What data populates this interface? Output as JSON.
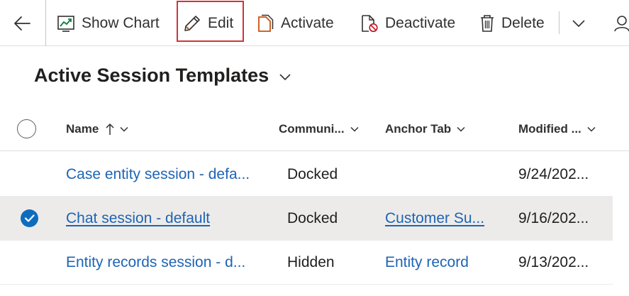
{
  "toolbar": {
    "show_chart": "Show Chart",
    "edit": "Edit",
    "activate": "Activate",
    "deactivate": "Deactivate",
    "delete": "Delete"
  },
  "view": {
    "title": "Active Session Templates"
  },
  "grid": {
    "columns": [
      "Name",
      "Communi...",
      "Anchor Tab",
      "Modified ..."
    ],
    "rows": [
      {
        "name": "Case entity session - defa...",
        "communication": "Docked",
        "anchor_tab": "",
        "modified": "9/24/202...",
        "selected": false
      },
      {
        "name": "Chat session - default",
        "communication": "Docked",
        "anchor_tab": "Customer Su...",
        "modified": "9/16/202...",
        "selected": true
      },
      {
        "name": "Entity records session - d...",
        "communication": "Hidden",
        "anchor_tab": "Entity record",
        "modified": "9/13/202...",
        "selected": false
      }
    ]
  },
  "colors": {
    "accent": "#0f6cbd",
    "link": "#1e64b4",
    "highlight_border": "#d13438",
    "selected_row": "#edebe9"
  },
  "icons": {
    "back": "back-arrow-icon",
    "show_chart": "chart-icon",
    "edit": "pencil-icon",
    "activate": "document-icon",
    "deactivate": "document-blocked-icon",
    "delete": "trash-icon",
    "more": "chevron-down-icon",
    "user": "person-icon",
    "sort": "sort-ascending-icon",
    "select_all": "circle-icon",
    "row_selected": "checkmark-circle-icon"
  }
}
